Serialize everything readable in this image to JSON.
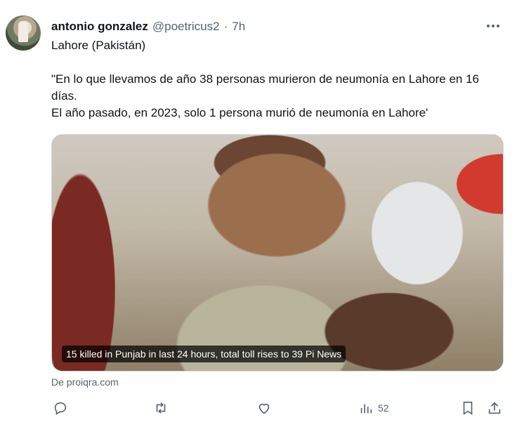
{
  "author": {
    "name": "antonio gonzalez",
    "handle": "@poetricus2",
    "separator": "·",
    "time": "7h"
  },
  "text": {
    "line1": "Lahore (Pakistán)",
    "line2": "\"En lo que llevamos de año 38 personas murieron de neumonía en Lahore en 16 días.",
    "line3": "El año pasado, en 2023, solo 1 persona murió de neumonía en Lahore'"
  },
  "media": {
    "caption": "15 killed in Punjab in last 24 hours, total toll rises to 39 Pi News"
  },
  "source": "De proiqra.com",
  "actions": {
    "reply_icon": "reply-icon",
    "retweet_icon": "retweet-icon",
    "like_icon": "heart-icon",
    "views_icon": "views-icon",
    "views_count": "52",
    "bookmark_icon": "bookmark-icon",
    "share_icon": "share-icon"
  },
  "colors": {
    "secondary_text": "#536471",
    "border": "#cfd9de"
  }
}
